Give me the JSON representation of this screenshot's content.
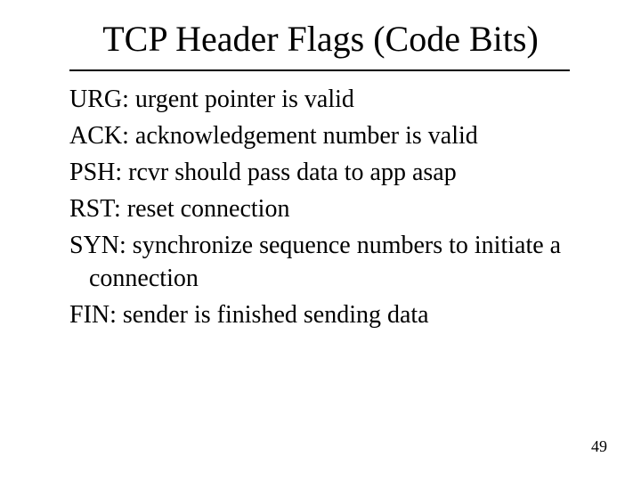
{
  "title": "TCP Header Flags (Code Bits)",
  "flags": {
    "urg": {
      "name": "URG:",
      "desc": " urgent pointer is valid"
    },
    "ack": {
      "name": "ACK:",
      "desc": " acknowledgement number is valid"
    },
    "psh": {
      "name": "PSH:",
      "desc": " rcvr should pass data to app asap"
    },
    "rst": {
      "name": "RST:",
      "desc": " reset connection"
    },
    "syn": {
      "name": "SYN:",
      "desc": " synchronize sequence numbers to initiate a connection"
    },
    "fin": {
      "name": "FIN:",
      "desc": " sender is finished sending data"
    }
  },
  "page_number": "49"
}
